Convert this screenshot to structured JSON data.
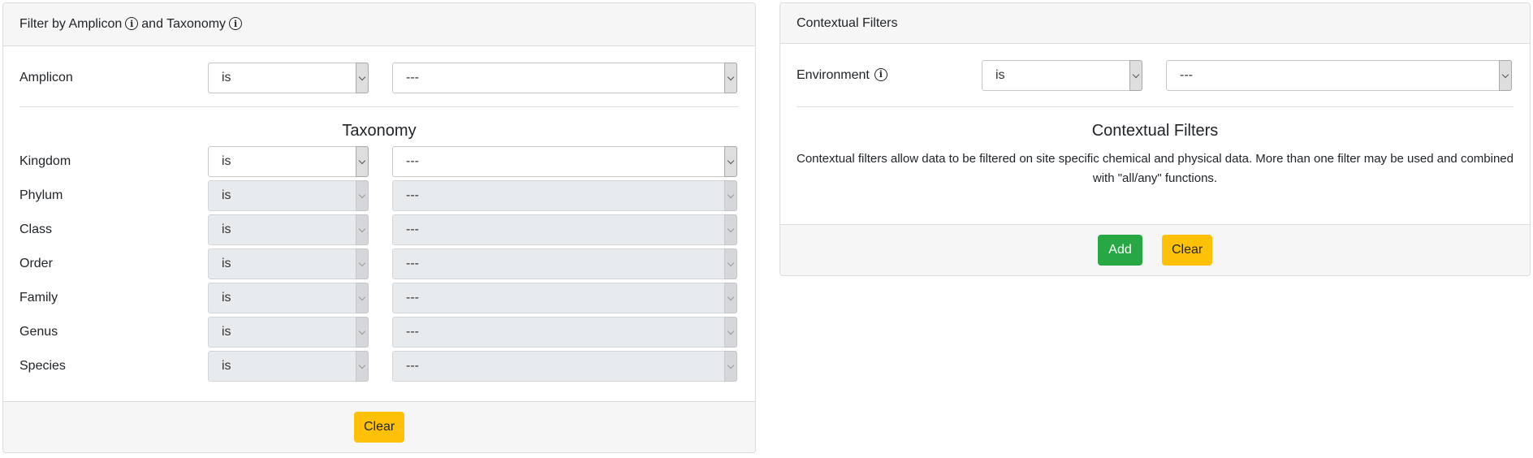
{
  "left_panel": {
    "header": {
      "part1": "Filter by Amplicon",
      "part2": "and Taxonomy"
    },
    "amplicon": {
      "label": "Amplicon",
      "operator": "is",
      "value": "---"
    },
    "taxonomy_heading": "Taxonomy",
    "taxonomy_rows": [
      {
        "label": "Kingdom",
        "operator": "is",
        "value": "---",
        "enabled": true
      },
      {
        "label": "Phylum",
        "operator": "is",
        "value": "---",
        "enabled": false
      },
      {
        "label": "Class",
        "operator": "is",
        "value": "---",
        "enabled": false
      },
      {
        "label": "Order",
        "operator": "is",
        "value": "---",
        "enabled": false
      },
      {
        "label": "Family",
        "operator": "is",
        "value": "---",
        "enabled": false
      },
      {
        "label": "Genus",
        "operator": "is",
        "value": "---",
        "enabled": false
      },
      {
        "label": "Species",
        "operator": "is",
        "value": "---",
        "enabled": false
      }
    ],
    "footer": {
      "clear_label": "Clear"
    }
  },
  "right_panel": {
    "header": "Contextual Filters",
    "environment": {
      "label": "Environment",
      "operator": "is",
      "value": "---"
    },
    "section_title": "Contextual Filters",
    "description": "Contextual filters allow data to be filtered on site specific chemical and physical data. More than one filter may be used and combined with \"all/any\" functions.",
    "footer": {
      "add_label": "Add",
      "clear_label": "Clear"
    }
  },
  "icons": {
    "info": "info-circle-icon",
    "dropdown": "chevron-down-icon"
  },
  "colors": {
    "warning": "#ffc107",
    "success": "#28a745",
    "header_bg": "#f6f6f6",
    "disabled_bg": "#e8ebee"
  }
}
